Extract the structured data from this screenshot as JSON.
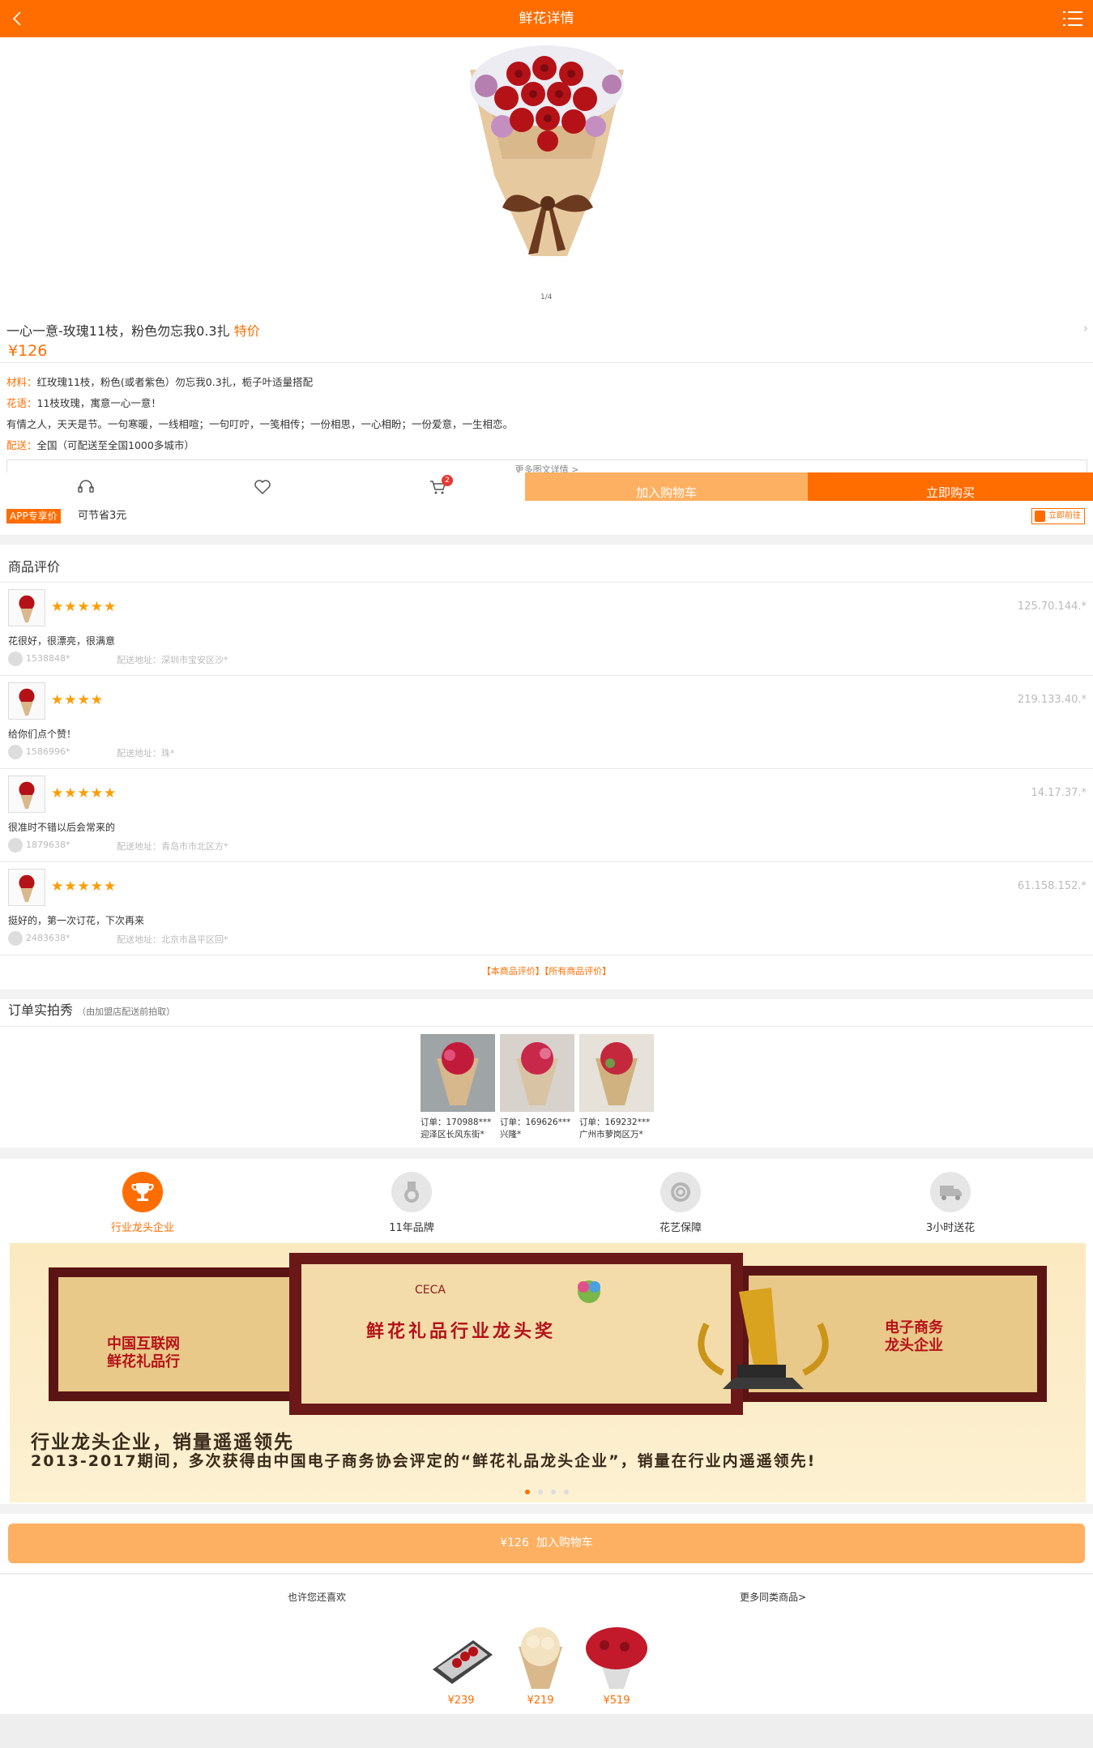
{
  "header": {
    "title": "鲜花详情"
  },
  "hero": {
    "pager": "1/4"
  },
  "product": {
    "title": "一心一意-玫瑰11枝，粉色勿忘我0.3扎",
    "tag": "特价",
    "price": "¥126",
    "attributes": [
      {
        "key": "材料：",
        "value": "红玫瑰11枝，粉色(或者紫色）勿忘我0.3扎，栀子叶适量搭配"
      },
      {
        "key": "花语：",
        "value": "11枝玫瑰，寓意一心一意！"
      },
      {
        "key": "",
        "value": "有情之人，天天是节。一句寒暖，一线相喧；一句叮咛，一笺相传；一份相思，一心相盼；一份爱意，一生相恋。"
      },
      {
        "key": "配送：",
        "value": "全国（可配送至全国1000多城市）"
      }
    ],
    "more_details": "更多图文详情 >"
  },
  "actions": {
    "cart_count": "2",
    "add_to_cart": "加入购物车",
    "buy_now": "立即购买"
  },
  "app_promo": {
    "badge": "APP专享价",
    "saving": "可节省3元",
    "go": "立即前往"
  },
  "reviews": {
    "title": "商品评价",
    "items": [
      {
        "stars": "★★★★★",
        "ip": "125.70.144.*",
        "text": "花很好，很漂亮，很满意",
        "user": "1538848*",
        "addr": "配送地址：深圳市宝安区沙*"
      },
      {
        "stars": "★★★★",
        "ip": "219.133.40.*",
        "text": "给你们点个赞！",
        "user": "1586996*",
        "addr": "配送地址：珠*"
      },
      {
        "stars": "★★★★★",
        "ip": "14.17.37.*",
        "text": "很准时不错以后会常来的",
        "user": "1879638*",
        "addr": "配送地址：青岛市市北区方*"
      },
      {
        "stars": "★★★★★",
        "ip": "61.158.152.*",
        "text": "挺好的，第一次订花，下次再来",
        "user": "2483638*",
        "addr": "配送地址：北京市昌平区回*"
      }
    ],
    "link_this": "【本商品评价】",
    "link_all": "【所有商品评价】"
  },
  "order_photos": {
    "title": "订单实拍秀",
    "subtitle": "（由加盟店配送前拍取）",
    "items": [
      {
        "order": "订单：170988***",
        "place": "迎泽区长风东街*"
      },
      {
        "order": "订单：169626***",
        "place": "兴隆*"
      },
      {
        "order": "订单：169232***",
        "place": "广州市萝岗区万*"
      }
    ]
  },
  "features": [
    {
      "label": "行业龙头企业",
      "icon": "trophy-icon"
    },
    {
      "label": "11年品牌",
      "icon": "medal-icon"
    },
    {
      "label": "花艺保障",
      "icon": "rose-icon"
    },
    {
      "label": "3小时送花",
      "icon": "truck-icon"
    }
  ],
  "banner": {
    "headline": "行业龙头企业，销量遥遥领先",
    "body": "2013-2017期间，多次获得由中国电子商务协会评定的“鲜花礼品龙头企业”，销量在行业内遥遥领先!",
    "plaque_text": "鲜花礼品行业龙头奖",
    "plaque_side": "中国互联网",
    "plaque_side2": "鲜花礼品行",
    "plaque_right": "电子商务",
    "plaque_right2": "龙头企业",
    "ceca": "CECA"
  },
  "bottom_cta": {
    "price": "¥126",
    "label": "加入购物车"
  },
  "recommendations": {
    "title": "也许您还喜欢",
    "more": "更多同类商品>",
    "items": [
      {
        "price": "¥239"
      },
      {
        "price": "¥219"
      },
      {
        "price": "¥519"
      }
    ]
  },
  "colors": {
    "accent": "#ff6d00",
    "accent_light": "#fdb061",
    "star": "#ff9c00"
  }
}
